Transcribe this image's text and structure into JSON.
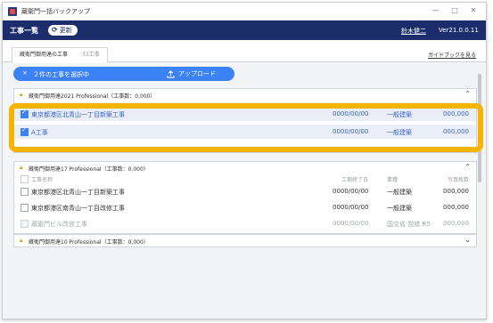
{
  "window": {
    "title": "蔵衛門一括バックアップ",
    "minimize": "—",
    "maximize": "□",
    "close": "✕"
  },
  "header": {
    "title": "工事一覧",
    "refresh_label": "更新",
    "user": "鈴木健二",
    "version": "Ver21.0.0.11"
  },
  "tab": {
    "label": "蔵衛門御用達の工事",
    "count": "33工事"
  },
  "guide_link": "ガイドブックを見る",
  "selection": {
    "close_icon": "×",
    "text": "２件の工事を選択中",
    "upload_label": "アップロード"
  },
  "groups": [
    {
      "title": "蔵衛門御用達2021 Professional（工事数：0,000）",
      "rows": [
        {
          "name": "東京都港区北青山一丁目新築工事",
          "date": "0000/00/00",
          "type": "一般建築",
          "photos": "000,000",
          "checked": true
        },
        {
          "name": "A工事",
          "date": "0000/00/00",
          "type": "一般建築",
          "photos": "000,000",
          "checked": true
        }
      ]
    },
    {
      "title": "蔵衛門御用達17 Professional（工事数：0,000）",
      "columns": {
        "name": "工事名称",
        "date": "工期終了日",
        "type": "業種",
        "photos": "写真枚数"
      },
      "rows": [
        {
          "name": "東京都港区北青山一丁目新築工事",
          "date": "0000/00/00",
          "type": "一般建築",
          "photos": "000,000",
          "checked": false
        },
        {
          "name": "東京都港区南青山一丁目改修工事",
          "date": "0000/00/00",
          "type": "一般建築",
          "photos": "000,000",
          "checked": false
        },
        {
          "name": "蔵衛門ビル改修工事",
          "date": "0000/00/00",
          "type": "国交省 営繕 R5",
          "photos": "000,000",
          "checked": false,
          "disabled": true
        }
      ]
    },
    {
      "title": "蔵衛門御用達10 Professional（工事数：0,000）"
    }
  ],
  "colors": {
    "header_bg": "#1c2d6b",
    "accent": "#3b82f6",
    "highlight": "#f5b400",
    "lock_icon": "#d69b00"
  },
  "icons": [
    "app-logo-icon",
    "refresh-icon",
    "close-icon",
    "upload-icon",
    "lock-icon",
    "chevron-up-icon",
    "chevron-down-icon",
    "checkbox-icon"
  ]
}
